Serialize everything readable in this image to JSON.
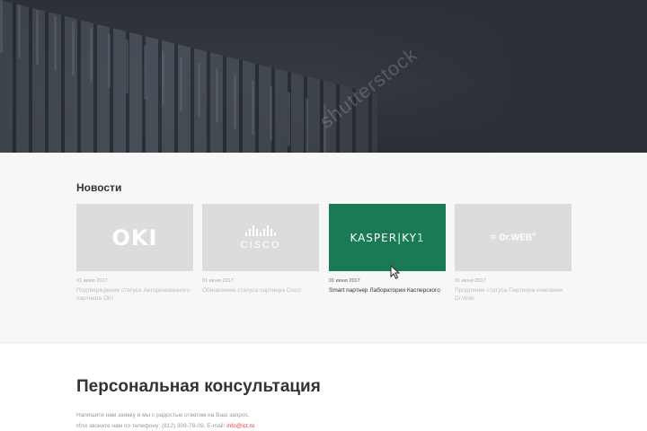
{
  "hero": {
    "watermark": "shutterstock"
  },
  "news": {
    "title": "Новости",
    "items": [
      {
        "logo": "OKI",
        "date": "01 июня 2017",
        "text": "Подтверждение статуса Авторизованного партнера OKI"
      },
      {
        "logo": "CISCO",
        "date": "01 июня 2017",
        "text": "Обновление статуса партнера Cisco"
      },
      {
        "logo": "KASPER|KY",
        "date": "01 июня 2017",
        "text": "Smart партнер Лаборатории Касперского",
        "active_color": "#1a7a56"
      },
      {
        "logo": "Dr.WEB",
        "date": "01 июня 2017",
        "text": "Продление статуса Партнера компании Dr.Web"
      }
    ]
  },
  "consult": {
    "title": "Персональная консультация",
    "line1": "Напишите нам заявку и мы с радостью ответим на Ваш запрос.",
    "line2_prefix": "Или звоните нам по телефону: (812) 309-78-09, E-mail: ",
    "email": "info@ict.ru"
  },
  "colors": {
    "accent": "#e0433a",
    "kaspersky_green": "#1a7a56",
    "card_gray": "#dcdcdc"
  }
}
